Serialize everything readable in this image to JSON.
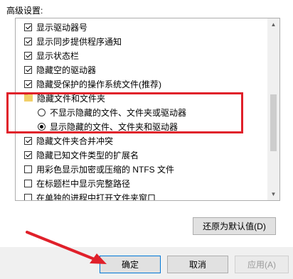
{
  "section_label": "高级设置:",
  "list_items": [
    {
      "type": "checkbox",
      "checked": true,
      "label": "显示驱动器号"
    },
    {
      "type": "checkbox",
      "checked": true,
      "label": "显示同步提供程序通知"
    },
    {
      "type": "checkbox",
      "checked": true,
      "label": "显示状态栏"
    },
    {
      "type": "checkbox",
      "checked": true,
      "label": "隐藏空的驱动器"
    },
    {
      "type": "checkbox",
      "checked": true,
      "label": "隐藏受保护的操作系统文件(推荐)"
    },
    {
      "type": "folder",
      "label": "隐藏文件和文件夹"
    },
    {
      "type": "radio",
      "checked": false,
      "label": "不显示隐藏的文件、文件夹或驱动器"
    },
    {
      "type": "radio",
      "checked": true,
      "label": "显示隐藏的文件、文件夹和驱动器"
    },
    {
      "type": "checkbox",
      "checked": true,
      "label": "隐藏文件夹合并冲突"
    },
    {
      "type": "checkbox",
      "checked": true,
      "label": "隐藏已知文件类型的扩展名"
    },
    {
      "type": "checkbox",
      "checked": false,
      "label": "用彩色显示加密或压缩的 NTFS 文件"
    },
    {
      "type": "checkbox",
      "checked": false,
      "label": "在标题栏中显示完整路径"
    },
    {
      "type": "checkbox",
      "checked": false,
      "label": "在单独的进程中打开文件夹窗口"
    }
  ],
  "buttons": {
    "restore_defaults": "还原为默认值(D)",
    "ok": "确定",
    "cancel": "取消",
    "apply": "应用(A)"
  },
  "annotation_colors": {
    "highlight": "#e0202a",
    "arrow": "#e0202a"
  }
}
